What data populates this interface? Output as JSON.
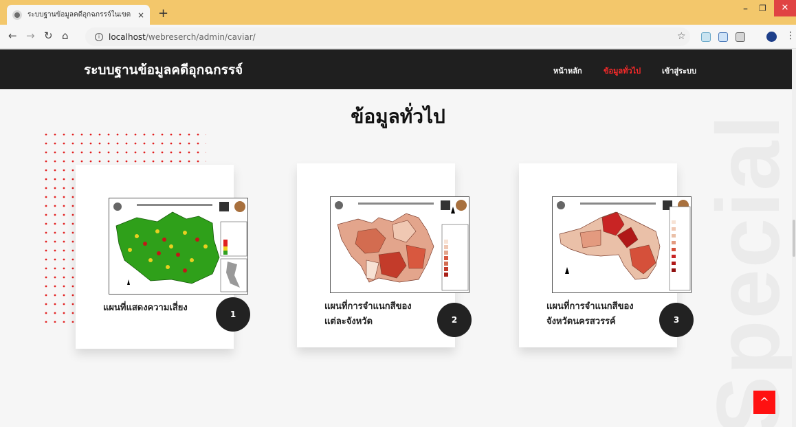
{
  "browser": {
    "tab_title": "ระบบฐานข้อมูลคดีอุกฉกรรจ์ในเขตภาค",
    "tab_close": "×",
    "new_tab": "+",
    "url_host": "localhost",
    "url_path": "/webreserch/admin/caviar/",
    "window_min": "–",
    "window_max": "❐",
    "window_close": "✕"
  },
  "header": {
    "title": "ระบบฐานข้อมูลคดีอุกฉกรรจ์",
    "nav": [
      {
        "label": "หน้าหลัก",
        "color": "#ffffff"
      },
      {
        "label": "ข้อมูลทั่วไป",
        "color": "#ff2a2a"
      },
      {
        "label": "เข้าสู่ระบบ",
        "color": "#ffffff"
      }
    ]
  },
  "main": {
    "heading": "ข้อมูลทั่วไป",
    "background_word": "Special",
    "cards": [
      {
        "title": "แผนที่แสดงความเสี่ยง",
        "number": "1"
      },
      {
        "title": "แผนที่การจำแนกสีของแต่ละจังหวัด",
        "number": "2"
      },
      {
        "title": "แผนที่การจำแนกสีของจังหวัดนครสวรรค์",
        "number": "3"
      }
    ]
  },
  "scroll_top": "^",
  "colors": {
    "accent": "#ff1a1a",
    "header_bg": "#1f1f1f",
    "tab_bar": "#f3c76b"
  }
}
